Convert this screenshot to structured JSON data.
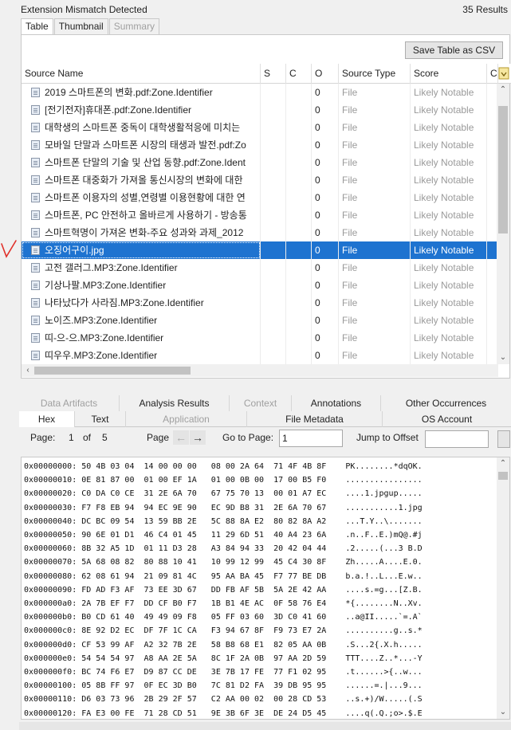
{
  "header": {
    "title": "Extension Mismatch Detected",
    "results": "35  Results"
  },
  "view_tabs": [
    {
      "label": "Table",
      "state": "active"
    },
    {
      "label": "Thumbnail",
      "state": "normal"
    },
    {
      "label": "Summary",
      "state": "disabled"
    }
  ],
  "toolbar": {
    "save_label": "Save Table as CSV"
  },
  "columns": [
    "Source Name",
    "S",
    "C",
    "O",
    "Source Type",
    "Score",
    "Co"
  ],
  "rows": [
    {
      "name": "2019 스마트폰의 변화.pdf:Zone.Identifier",
      "o": "0",
      "type": "File",
      "score": "Likely Notable"
    },
    {
      "name": "[전기전자]휴대폰.pdf:Zone.Identifier",
      "o": "0",
      "type": "File",
      "score": "Likely Notable"
    },
    {
      "name": "대학생의 스마트폰 중독이 대학생활적응에 미치는",
      "o": "0",
      "type": "File",
      "score": "Likely Notable"
    },
    {
      "name": "모바일 단말과 스마트폰 시장의 태생과 발전.pdf:Zo",
      "o": "0",
      "type": "File",
      "score": "Likely Notable"
    },
    {
      "name": "스마트폰 단말의 기술 및 산업 동향.pdf:Zone.Ident",
      "o": "0",
      "type": "File",
      "score": "Likely Notable"
    },
    {
      "name": "스마트폰 대중화가 가져올 통신시장의 변화에 대한",
      "o": "0",
      "type": "File",
      "score": "Likely Notable"
    },
    {
      "name": "스마트폰 이용자의 성별,연령별 이용현황에 대한 연",
      "o": "0",
      "type": "File",
      "score": "Likely Notable"
    },
    {
      "name": "스마트폰, PC 안전하고 올바르게 사용하기 - 방송통",
      "o": "0",
      "type": "File",
      "score": "Likely Notable"
    },
    {
      "name": "스마트혁명이 가져온 변화-주요 성과와 과제_2012",
      "o": "0",
      "type": "File",
      "score": "Likely Notable"
    },
    {
      "name": "오징어구이.jpg",
      "o": "0",
      "type": "File",
      "score": "Likely Notable",
      "selected": true
    },
    {
      "name": "고전 갤러그.MP3:Zone.Identifier",
      "o": "0",
      "type": "File",
      "score": "Likely Notable"
    },
    {
      "name": "기상나팔.MP3:Zone.Identifier",
      "o": "0",
      "type": "File",
      "score": "Likely Notable"
    },
    {
      "name": "나타났다가 사라짐.MP3:Zone.Identifier",
      "o": "0",
      "type": "File",
      "score": "Likely Notable"
    },
    {
      "name": "노이즈.MP3:Zone.Identifier",
      "o": "0",
      "type": "File",
      "score": "Likely Notable"
    },
    {
      "name": "띠-으-으.MP3:Zone.Identifier",
      "o": "0",
      "type": "File",
      "score": "Likely Notable"
    },
    {
      "name": "띠우우.MP3:Zone.Identifier",
      "o": "0",
      "type": "File",
      "score": "Likely Notable"
    }
  ],
  "content_tabs_row1": [
    {
      "label": "Data Artifacts",
      "disabled": true
    },
    {
      "label": "Analysis Results",
      "disabled": false
    },
    {
      "label": "Context",
      "disabled": true
    },
    {
      "label": "Annotations",
      "disabled": false
    },
    {
      "label": "Other Occurrences",
      "disabled": false
    }
  ],
  "content_tabs_row2": [
    {
      "label": "Hex",
      "disabled": false,
      "active": true
    },
    {
      "label": "Text",
      "disabled": false
    },
    {
      "label": "Application",
      "disabled": true
    },
    {
      "label": "File Metadata",
      "disabled": false
    },
    {
      "label": "OS Account",
      "disabled": false
    }
  ],
  "hex_toolbar": {
    "page_label": "Page:",
    "page_current": "1",
    "of_label": "of",
    "page_total": "5",
    "page_nav_label": "Page",
    "goto_label": "Go to Page:",
    "goto_value": "1",
    "offset_label": "Jump to Offset",
    "offset_value": ""
  },
  "hex_lines": [
    "0x00000000: 50 4B 03 04  14 00 00 00   08 00 2A 64  71 4F 4B 8F    PK........*dqOK.",
    "0x00000010: 0E 81 87 00  01 00 EF 1A   01 00 0B 00  17 00 B5 F0    ................",
    "0x00000020: C0 DA C0 CE  31 2E 6A 70   67 75 70 13  00 01 A7 EC    ....1.jpgup.....",
    "0x00000030: F7 F8 EB 94  94 EC 9E 90   EC 9D B8 31  2E 6A 70 67    ...........1.jpg",
    "0x00000040: DC BC 09 54  13 59 BB 2E   5C 88 8A E2  80 82 8A A2    ...T.Y..\\.......",
    "0x00000050: 90 6E 01 D1  46 C4 01 45   11 29 6D 51  40 A4 23 6A    .n..F..E.)mQ@.#j",
    "0x00000060: 8B 32 A5 1D  01 11 D3 28   A3 84 94 33  20 42 04 44    .2.....(...3 B.D",
    "0x00000070: 5A 68 08 82  80 88 10 41   10 99 12 99  45 C4 30 8F    Zh.....A....E.0.",
    "0x00000080: 62 08 61 94  21 09 81 4C   95 AA BA 45  F7 77 BE DB    b.a.!..L...E.w..",
    "0x00000090: FD AD F3 AF  73 EE 3D 67   DD FB AF 5B  5A 2E 42 AA    ....s.=g...[Z.B.",
    "0x000000a0: 2A 7B EF F7  DD CF B0 F7   1B B1 4E AC  0F 58 76 E4    *{........N..Xv.",
    "0x000000b0: B0 CD 61 40  49 49 09 F8   05 FF 03 60  3D C0 41 60    ..a@II.....`=.A`",
    "0x000000c0: 8E 92 D2 EC  DF 7F 1C CA   F3 94 67 8F  F9 73 E7 2A    ..........g..s.*",
    "0x000000d0: CF 53 99 AF  A2 32 7B 2E   58 B8 68 E1  82 05 AA 0B    .S...2{.X.h.....",
    "0x000000e0: 54 54 54 97  A8 AA 2E 5A   8C 1F 2A 0B  97 AA 2D 59    TTT....Z..*...-Y",
    "0x000000f0: BC 74 F6 E7  D9 87 CC DE   3E 7B 17 FE  77 F1 02 95    .t......>{..w...",
    "0x00000100: 05 8B FF 97  0F EC 3D B0   7C 81 D2 FA  39 DB 95 95    ......=.|...9...",
    "0x00000110: D6 03 73 96  2B 29 2F 57   C2 AA 00 02  00 28 CD 53    ..s.+)/W.....(.S",
    "0x00000120: FA E3 00 FE  71 28 CD 51   9E 3B 6F 3E  DE 24 D5 45    ....q(.Q.;o>.$.E"
  ],
  "colors": {
    "selection": "#1e73d0",
    "annotation_mark": "#e0302a"
  }
}
